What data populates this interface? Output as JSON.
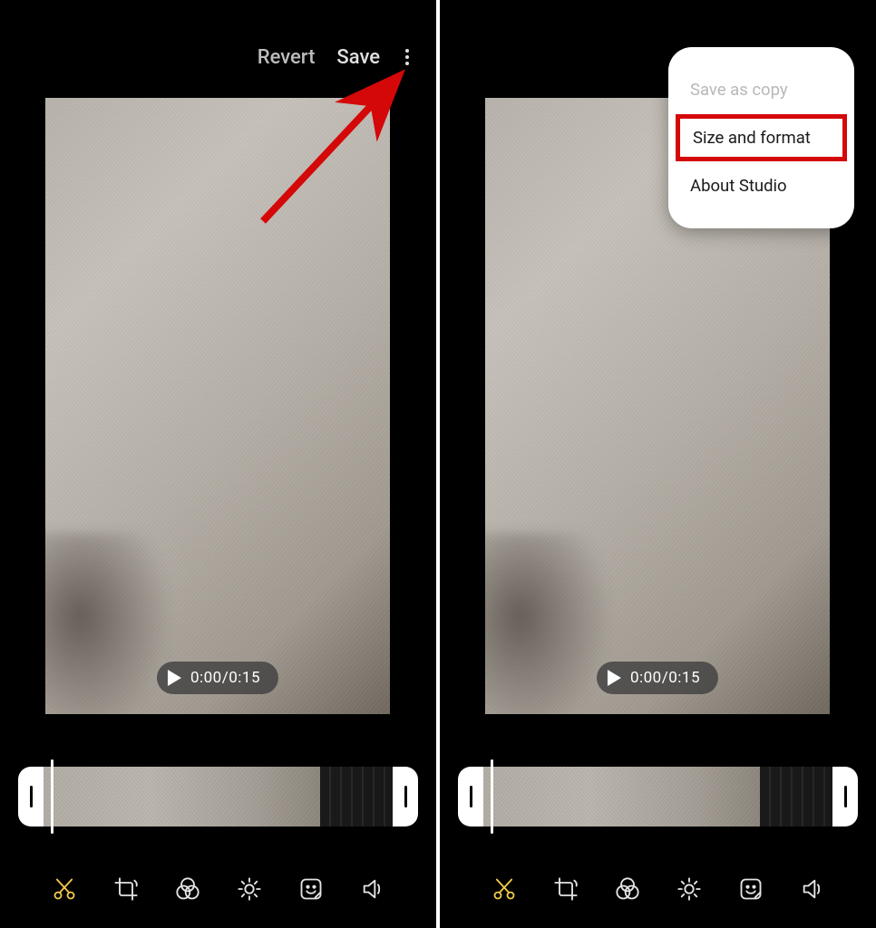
{
  "topbar": {
    "revert_label": "Revert",
    "save_label": "Save"
  },
  "playback": {
    "time_display": "0:00/0:15"
  },
  "menu": {
    "save_as_copy": "Save as copy",
    "size_and_format": "Size and format",
    "about_studio": "About Studio"
  },
  "tools": {
    "trim": "trim",
    "crop": "crop",
    "filters": "filters",
    "adjust": "adjust",
    "sticker": "sticker",
    "audio": "audio"
  }
}
